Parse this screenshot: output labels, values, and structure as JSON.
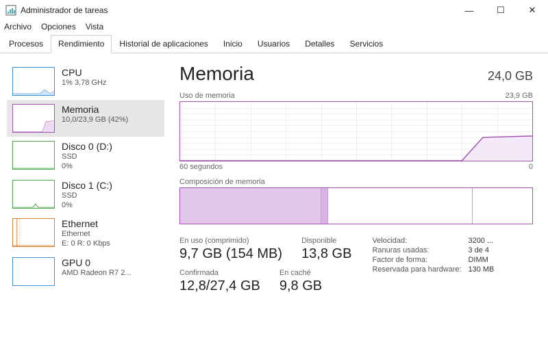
{
  "window": {
    "title": "Administrador de tareas",
    "min": "—",
    "max": "☐",
    "close": "✕"
  },
  "menu": {
    "file": "Archivo",
    "options": "Opciones",
    "view": "Vista"
  },
  "tabs": {
    "procesos": "Procesos",
    "rendimiento": "Rendimiento",
    "historial": "Historial de aplicaciones",
    "inicio": "Inicio",
    "usuarios": "Usuarios",
    "detalles": "Detalles",
    "servicios": "Servicios"
  },
  "sidebar": {
    "cpu": {
      "title": "CPU",
      "sub": "1% 3,78 GHz"
    },
    "memoria": {
      "title": "Memoria",
      "sub": "10,0/23,9 GB (42%)"
    },
    "disk0": {
      "title": "Disco 0 (D:)",
      "sub1": "SSD",
      "sub2": "0%"
    },
    "disk1": {
      "title": "Disco 1 (C:)",
      "sub1": "SSD",
      "sub2": "0%"
    },
    "eth": {
      "title": "Ethernet",
      "sub1": "Ethernet",
      "sub2": "E: 0 R: 0 Kbps"
    },
    "gpu": {
      "title": "GPU 0",
      "sub1": "AMD Radeon R7 2..."
    }
  },
  "main": {
    "title": "Memoria",
    "total": "24,0 GB",
    "usage_label": "Uso de memoria",
    "usage_max": "23,9 GB",
    "time_left": "60 segundos",
    "time_right": "0",
    "comp_label": "Composición de memoria",
    "inuse_lbl": "En uso (comprimido)",
    "inuse_val": "9,7 GB (154 MB)",
    "avail_lbl": "Disponible",
    "avail_val": "13,8 GB",
    "commit_lbl": "Confirmada",
    "commit_val": "12,8/27,4 GB",
    "cache_lbl": "En caché",
    "cache_val": "9,8 GB",
    "speed_lbl": "Velocidad:",
    "speed_val": "3200 ...",
    "slots_lbl": "Ranuras usadas:",
    "slots_val": "3 de 4",
    "form_lbl": "Factor de forma:",
    "form_val": "DIMM",
    "hw_lbl": "Reservada para hardware:",
    "hw_val": "130 MB"
  },
  "chart_data": {
    "type": "line",
    "title": "Uso de memoria",
    "xlabel": "60 segundos → 0",
    "ylabel": "GB",
    "ylim": [
      0,
      23.9
    ],
    "x": [
      60,
      50,
      40,
      30,
      20,
      15,
      10,
      5,
      0
    ],
    "values": [
      0,
      0,
      0,
      0,
      0,
      0,
      2.0,
      9.8,
      10.0
    ],
    "composition": {
      "in_use_gb": 9.7,
      "compressed_mb": 154,
      "modified_gb": 0.3,
      "standby_gb": 9.8,
      "free_gb": 4.0,
      "total_gb": 23.9
    }
  }
}
